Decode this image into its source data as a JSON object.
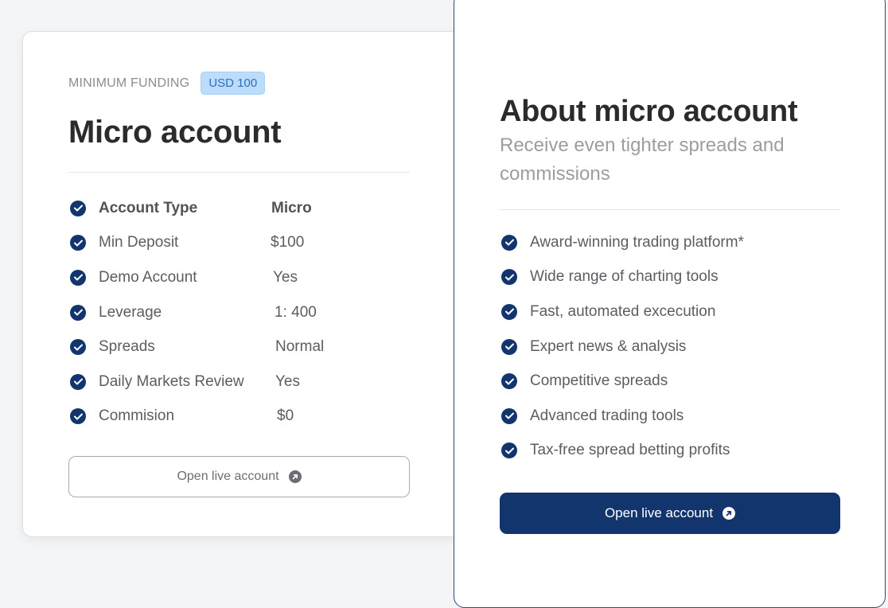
{
  "micro_card": {
    "funding_label": "MINIMUM FUNDING",
    "funding_badge": "USD 100",
    "title": "Micro account",
    "specs": [
      {
        "label": "Account Type",
        "value": "Micro"
      },
      {
        "label": "Min Deposit",
        "value": "$100"
      },
      {
        "label": "Demo Account",
        "value": "Yes"
      },
      {
        "label": "Leverage",
        "value": "1: 400"
      },
      {
        "label": "Spreads",
        "value": "Normal"
      },
      {
        "label": "Daily Markets Review",
        "value": "Yes"
      },
      {
        "label": "Commision",
        "value": "$0"
      }
    ],
    "button_label": "Open live account"
  },
  "about_card": {
    "title": "About micro account",
    "subtitle": "Receive even tighter spreads and commissions",
    "features": [
      "Award-winning trading platform*",
      "Wide range of charting tools",
      "Fast, automated excecution",
      "Expert news & analysis",
      "Competitive spreads",
      "Advanced trading tools",
      "Tax-free spread betting profits"
    ],
    "button_label": "Open live account"
  },
  "colors": {
    "accent": "#13356e",
    "badge_bg": "#bcdcfb",
    "badge_text": "#2f6fc0"
  },
  "icons": {
    "check": "check-circle-icon",
    "arrow": "arrow-up-right-circle-icon"
  }
}
